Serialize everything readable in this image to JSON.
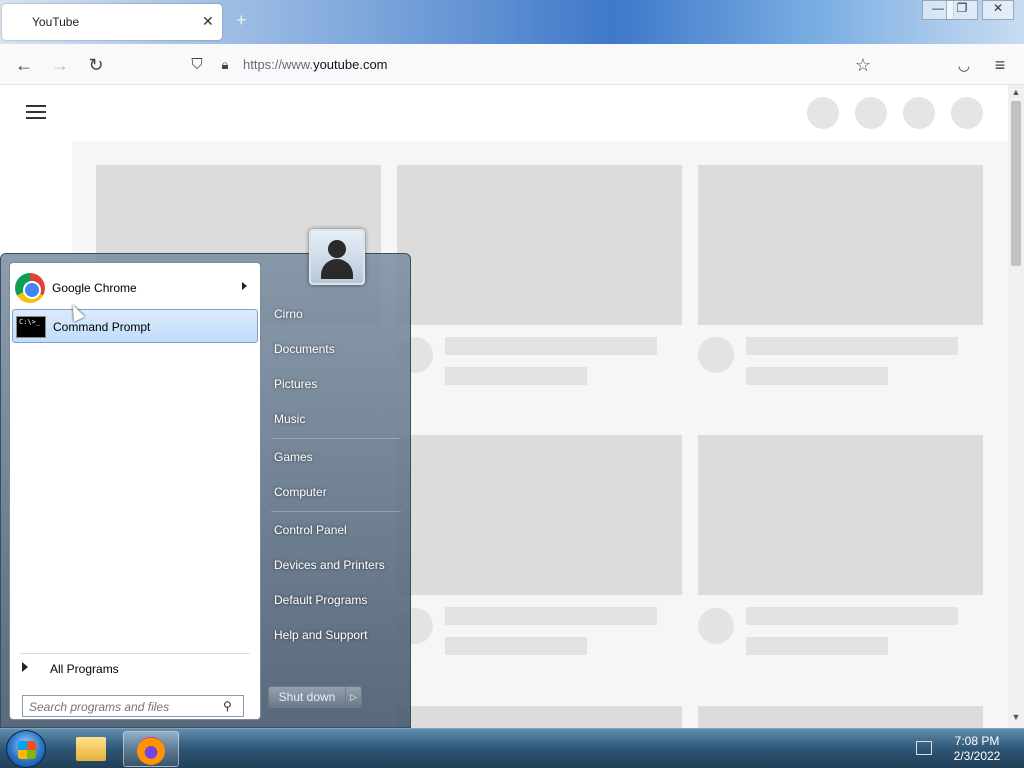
{
  "browser": {
    "tab_title": "YouTube",
    "tab_close": "✕",
    "new_tab": "+",
    "url_prefix": "https://www.",
    "url_host": "youtube.com",
    "window_controls": {
      "minimize": "—",
      "restore": "❐",
      "close": "✕"
    }
  },
  "start_menu": {
    "programs": [
      {
        "label": "Google Chrome",
        "icon": "chrome-icon",
        "has_submenu": true
      },
      {
        "label": "Command Prompt",
        "icon": "cmd-icon",
        "has_submenu": false
      }
    ],
    "cmd_icon_text": "C:\\>_",
    "all_programs_label": "All Programs",
    "search_placeholder": "Search programs and files",
    "right_items": {
      "user": "Cirno",
      "documents": "Documents",
      "pictures": "Pictures",
      "music": "Music",
      "games": "Games",
      "computer": "Computer",
      "control_panel": "Control Panel",
      "devices_printers": "Devices and Printers",
      "default_programs": "Default Programs",
      "help_support": "Help and Support"
    },
    "shutdown_label": "Shut down",
    "shutdown_arrow": "▷"
  },
  "taskbar": {
    "time": "7:08 PM",
    "date": "2/3/2022",
    "apps": [
      "windows-explorer-icon",
      "firefox-icon"
    ]
  }
}
